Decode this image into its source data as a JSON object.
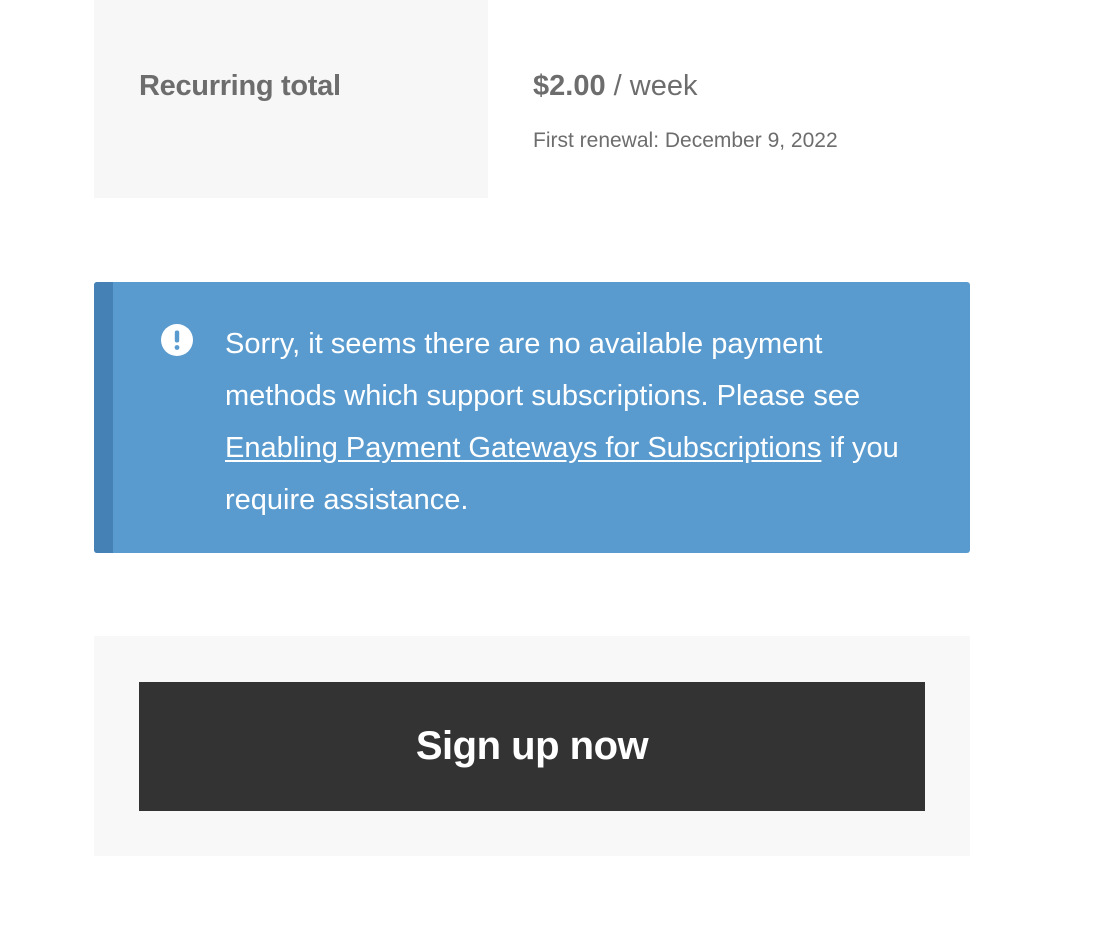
{
  "recurring_totals": {
    "label": "Recurring total",
    "amount": "$2.00",
    "period": " / week",
    "first_renewal": "First renewal: December 9, 2022"
  },
  "notice": {
    "icon": "exclamation-circle-icon",
    "text_before": "Sorry, it seems there are no available payment methods which support subscriptions. Please see ",
    "link_text": "Enabling Payment Gateways for Subscriptions",
    "text_after": " if you require assistance.",
    "background_color": "#5a9bcf",
    "accent_color": "#4581b4"
  },
  "place_order": {
    "button_label": "Sign up now",
    "button_color": "#333333"
  }
}
